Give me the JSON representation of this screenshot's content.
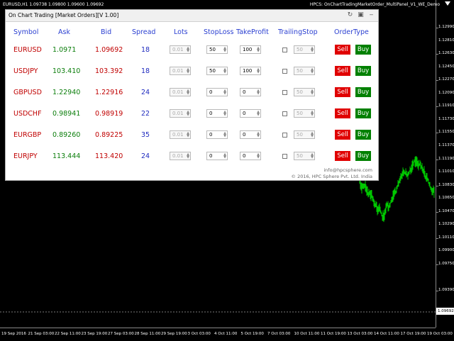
{
  "chart": {
    "header": "EURUSD,H1  1.09738 1.09800 1.09600 1.09692",
    "title_right": "HPCS: OnChartTradingMarketOrder_MultiPanel_V1_WE_Demo",
    "current_price": "1.09692",
    "price_labels": [
      "1.12990",
      "1.12630",
      "1.12270",
      "1.11910",
      "1.11550",
      "1.11190",
      "1.10830",
      "1.10470",
      "1.10110",
      "1.09750",
      "1.09390"
    ],
    "price_labels_extra": [
      "1.12810",
      "1.12450",
      "1.12090",
      "1.11730",
      "1.11370",
      "1.11010",
      "1.10650",
      "1.10290",
      "1.09900"
    ],
    "time_labels": [
      "19 Sep 2016",
      "21 Sep 03:00",
      "22 Sep 11:00",
      "23 Sep 19:00",
      "27 Sep 03:00",
      "28 Sep 11:00",
      "29 Sep 19:00",
      "3 Oct 03:00",
      "4 Oct 11:00",
      "5 Oct 19:00",
      "7 Oct 03:00",
      "10 Oct 11:00",
      "11 Oct 19:00",
      "13 Oct 03:00",
      "14 Oct 11:00",
      "17 Oct 19:00",
      "19 Oct 03:00"
    ],
    "line_color": "#00c800"
  },
  "panel": {
    "title": "On Chart Trading [Market Orders][V 1.00]",
    "headers": {
      "symbol": "Symbol",
      "ask": "Ask",
      "bid": "Bid",
      "spread": "Spread",
      "lots": "Lots",
      "stoploss": "StopLoss",
      "takeprofit": "TakeProfit",
      "trailingstop": "TrailingStop",
      "ordertype": "OrderType"
    },
    "sell_label": "Sell",
    "buy_label": "Buy",
    "rows": [
      {
        "symbol": "EURUSD",
        "ask": "1.0971",
        "bid": "1.09692",
        "spread": "18",
        "lots": "0.01",
        "sl": "50",
        "tp": "100",
        "ts": "50"
      },
      {
        "symbol": "USDJPY",
        "ask": "103.410",
        "bid": "103.392",
        "spread": "18",
        "lots": "0.01",
        "sl": "50",
        "tp": "100",
        "ts": "50"
      },
      {
        "symbol": "GBPUSD",
        "ask": "1.22940",
        "bid": "1.22916",
        "spread": "24",
        "lots": "0.01",
        "sl": "0",
        "tp": "0",
        "ts": "50"
      },
      {
        "symbol": "USDCHF",
        "ask": "0.98941",
        "bid": "0.98919",
        "spread": "22",
        "lots": "0.01",
        "sl": "0",
        "tp": "0",
        "ts": "50"
      },
      {
        "symbol": "EURGBP",
        "ask": "0.89260",
        "bid": "0.89225",
        "spread": "35",
        "lots": "0.01",
        "sl": "0",
        "tp": "0",
        "ts": "50"
      },
      {
        "symbol": "EURJPY",
        "ask": "113.444",
        "bid": "113.420",
        "spread": "24",
        "lots": "0.01",
        "sl": "0",
        "tp": "0",
        "ts": "50"
      }
    ],
    "footer_line1": "info@hpcsphere.com",
    "footer_line2": "© 2016, HPC Sphere Pvt. Ltd. India"
  }
}
